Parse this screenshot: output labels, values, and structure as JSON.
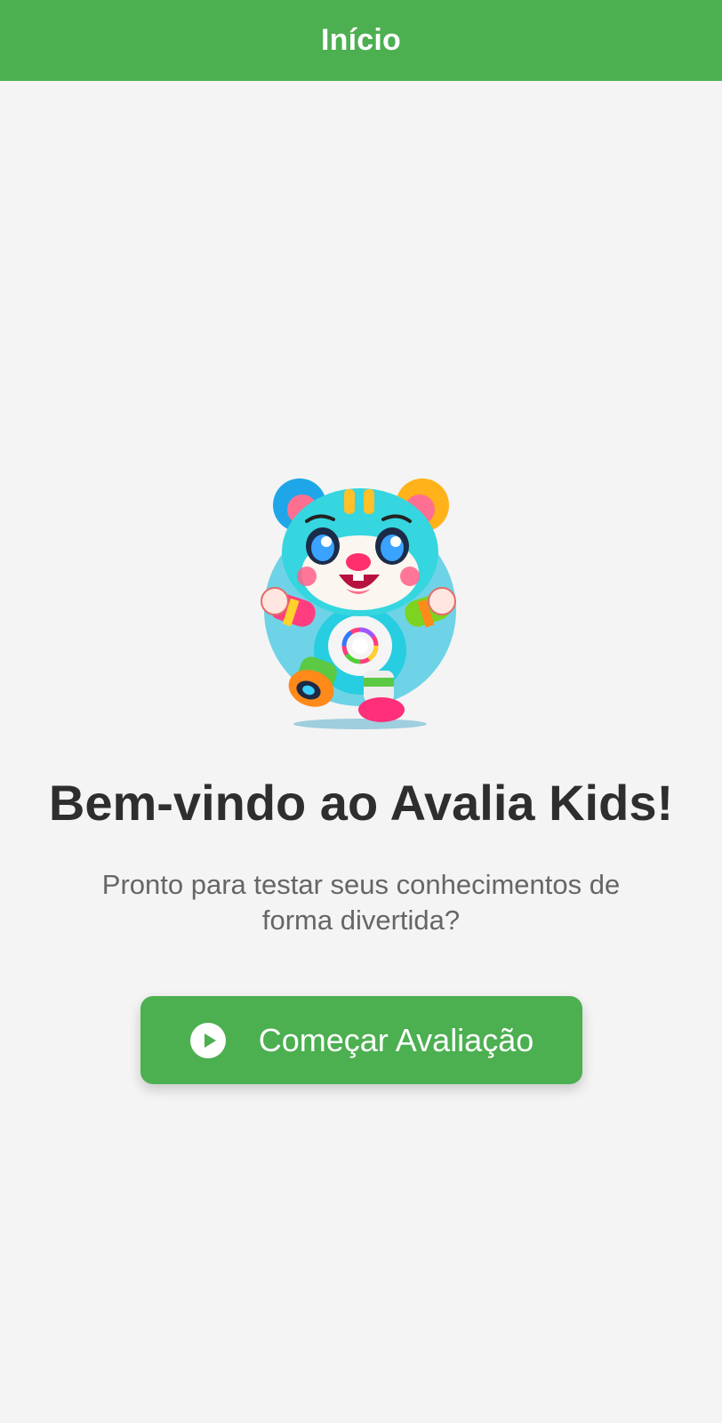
{
  "header": {
    "title": "Início"
  },
  "welcome": {
    "title": "Bem-vindo ao Avalia Kids!",
    "subtitle": "Pronto para testar seus conhecimentos de forma divertida?"
  },
  "start_button": {
    "label": "Começar Avaliação",
    "icon": "play-circle-icon"
  },
  "mascot": {
    "icon": "bear-mascot-illustration"
  },
  "colors": {
    "primary": "#4caf50",
    "background": "#f4f4f4",
    "title_text": "#2e2e2e",
    "subtitle_text": "#666666"
  }
}
